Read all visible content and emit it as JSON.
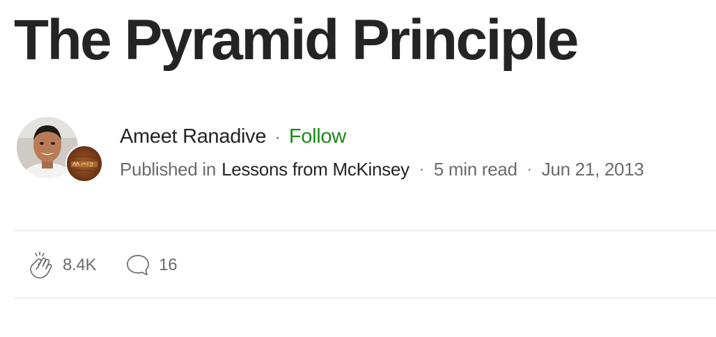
{
  "article": {
    "title": "The Pyramid Principle"
  },
  "author": {
    "name": "Ameet Ranadive",
    "separator": "·",
    "follow_label": "Follow",
    "avatar_icon": "author-avatar-photo"
  },
  "publication": {
    "published_in_label": "Published in",
    "name": "Lessons from McKinsey",
    "avatar_icon": "publication-logo"
  },
  "meta": {
    "separator": "·",
    "read_time": "5 min read",
    "date": "Jun 21, 2013"
  },
  "engagement": {
    "claps_icon": "clap-icon",
    "claps_count": "8.4K",
    "responses_icon": "comment-bubble-icon",
    "responses_count": "16"
  },
  "colors": {
    "title": "#242424",
    "text": "#242424",
    "muted": "#6b6b6b",
    "follow": "#1a8917",
    "divider": "#eeeeee"
  }
}
